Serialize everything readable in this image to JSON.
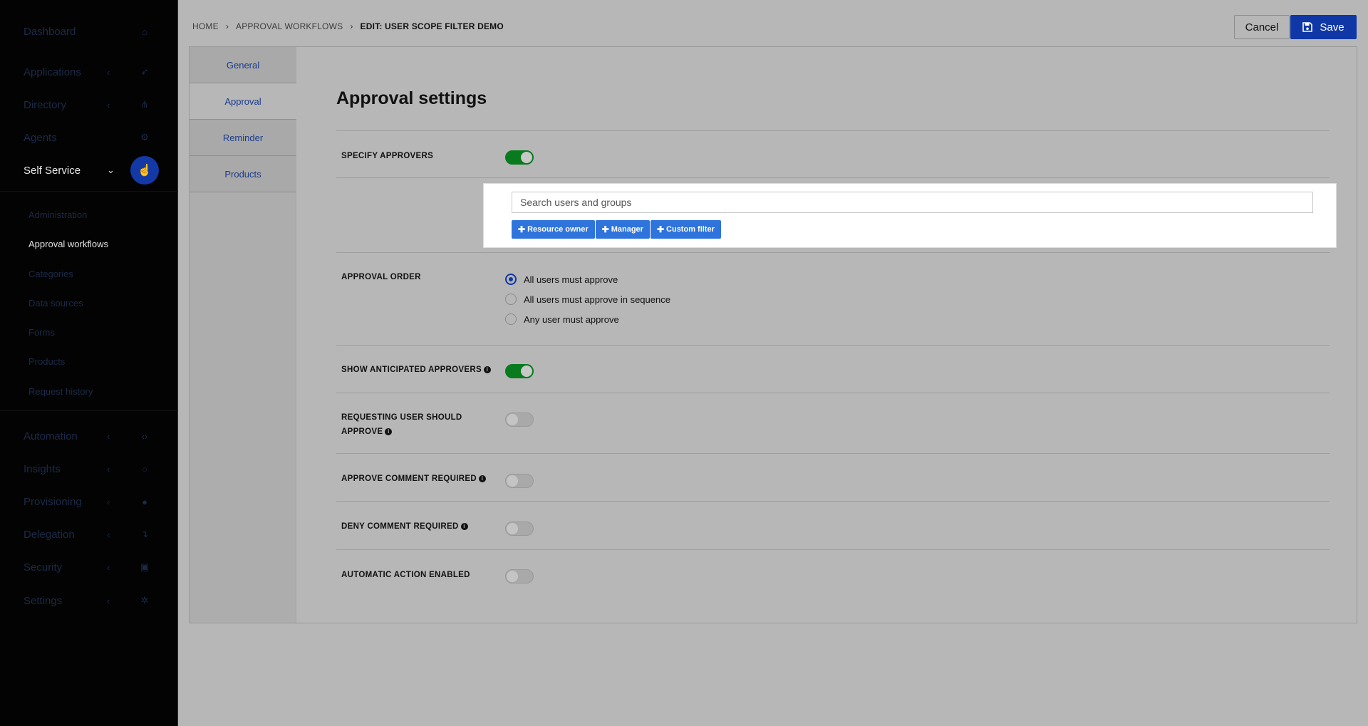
{
  "sidebar": {
    "items": [
      {
        "label": "Dashboard",
        "icon": "home-icon",
        "glyph": "⌂"
      },
      {
        "label": "Applications",
        "icon": "rocket-icon",
        "glyph": "➶"
      },
      {
        "label": "Directory",
        "icon": "sitemap-icon",
        "glyph": "⋔"
      },
      {
        "label": "Agents",
        "icon": "cogs-icon",
        "glyph": "⚙"
      },
      {
        "label": "Self Service",
        "icon": "hand-pointer-icon",
        "glyph": "☝"
      },
      {
        "label": "Automation",
        "icon": "code-icon",
        "glyph": "‹›"
      },
      {
        "label": "Insights",
        "icon": "lightbulb-icon",
        "glyph": "○"
      },
      {
        "label": "Provisioning",
        "icon": "users-icon",
        "glyph": "●"
      },
      {
        "label": "Delegation",
        "icon": "level-down-icon",
        "glyph": "↴"
      },
      {
        "label": "Security",
        "icon": "lock-icon",
        "glyph": "▣"
      },
      {
        "label": "Settings",
        "icon": "gear-icon",
        "glyph": "✲"
      }
    ],
    "chevron_collapsed": "‹",
    "chevron_expanded": "⌄",
    "sub_items": [
      {
        "label": "Administration"
      },
      {
        "label": "Approval workflows"
      },
      {
        "label": "Categories"
      },
      {
        "label": "Data sources"
      },
      {
        "label": "Forms"
      },
      {
        "label": "Products"
      },
      {
        "label": "Request history"
      }
    ]
  },
  "breadcrumb": {
    "home": "HOME",
    "sep": "›",
    "workflows": "APPROVAL WORKFLOWS",
    "current": "EDIT: USER SCOPE FILTER DEMO"
  },
  "toolbar": {
    "cancel_label": "Cancel",
    "save_label": "Save"
  },
  "tabs": [
    {
      "label": "General"
    },
    {
      "label": "Approval"
    },
    {
      "label": "Reminder"
    },
    {
      "label": "Products"
    }
  ],
  "content": {
    "title": "Approval settings",
    "specify_approvers": {
      "label": "SPECIFY APPROVERS",
      "enabled": true
    },
    "approvers": {
      "search_placeholder": "Search users and groups",
      "chips": [
        "Resource owner",
        "Manager",
        "Custom filter"
      ],
      "chip_plus": "✚"
    },
    "approval_order": {
      "label": "APPROVAL ORDER",
      "options": [
        "All users must approve",
        "All users must approve in sequence",
        "Any user must approve"
      ],
      "selected": 0
    },
    "show_anticipated": {
      "label": "SHOW ANTICIPATED APPROVERS",
      "enabled": true
    },
    "requesting_user": {
      "label_line1": "REQUESTING USER SHOULD",
      "label_line2": "APPROVE",
      "enabled": false
    },
    "approve_comment": {
      "label": "APPROVE COMMENT REQUIRED",
      "enabled": false
    },
    "deny_comment": {
      "label": "DENY COMMENT REQUIRED",
      "enabled": false
    },
    "automatic_action": {
      "label": "AUTOMATIC ACTION ENABLED",
      "enabled": false
    },
    "info_glyph": "i"
  }
}
